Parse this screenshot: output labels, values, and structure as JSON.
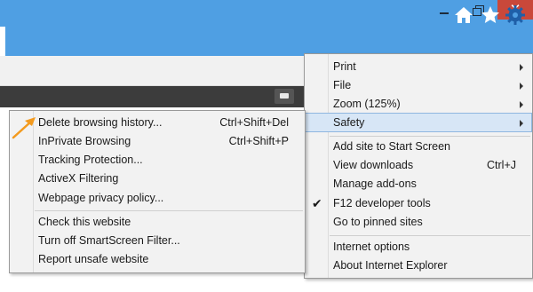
{
  "window": {
    "minimize_icon": "minimize-icon",
    "maximize_icon": "restore-icon",
    "close_glyph": "✕",
    "close_color": "#c9483a",
    "titlebar_color": "#4f9fe3"
  },
  "toolbar": {
    "icons": [
      "home-icon",
      "star-icon",
      "gear-icon"
    ]
  },
  "tools_menu": {
    "items": [
      {
        "label": "Print",
        "submenu": true
      },
      {
        "label": "File",
        "submenu": true
      },
      {
        "label": "Zoom (125%)",
        "submenu": true
      },
      {
        "label": "Safety",
        "submenu": true,
        "highlighted": true
      },
      {
        "label": "Add site to Start Screen"
      },
      {
        "label": "View downloads",
        "shortcut": "Ctrl+J"
      },
      {
        "label": "Manage add-ons"
      },
      {
        "label": "F12 developer tools",
        "checked": true
      },
      {
        "label": "Go to pinned sites"
      },
      {
        "label": "Internet options"
      },
      {
        "label": "About Internet Explorer"
      }
    ]
  },
  "safety_menu": {
    "items": [
      {
        "label": "Delete browsing history...",
        "shortcut": "Ctrl+Shift+Del"
      },
      {
        "label": "InPrivate Browsing",
        "shortcut": "Ctrl+Shift+P"
      },
      {
        "label": "Tracking Protection..."
      },
      {
        "label": "ActiveX Filtering"
      },
      {
        "label": "Webpage privacy policy..."
      },
      {
        "label": "Check this website"
      },
      {
        "label": "Turn off SmartScreen Filter..."
      },
      {
        "label": "Report unsafe website"
      }
    ]
  },
  "annotation": {
    "arrow_color": "#f39a1e"
  }
}
